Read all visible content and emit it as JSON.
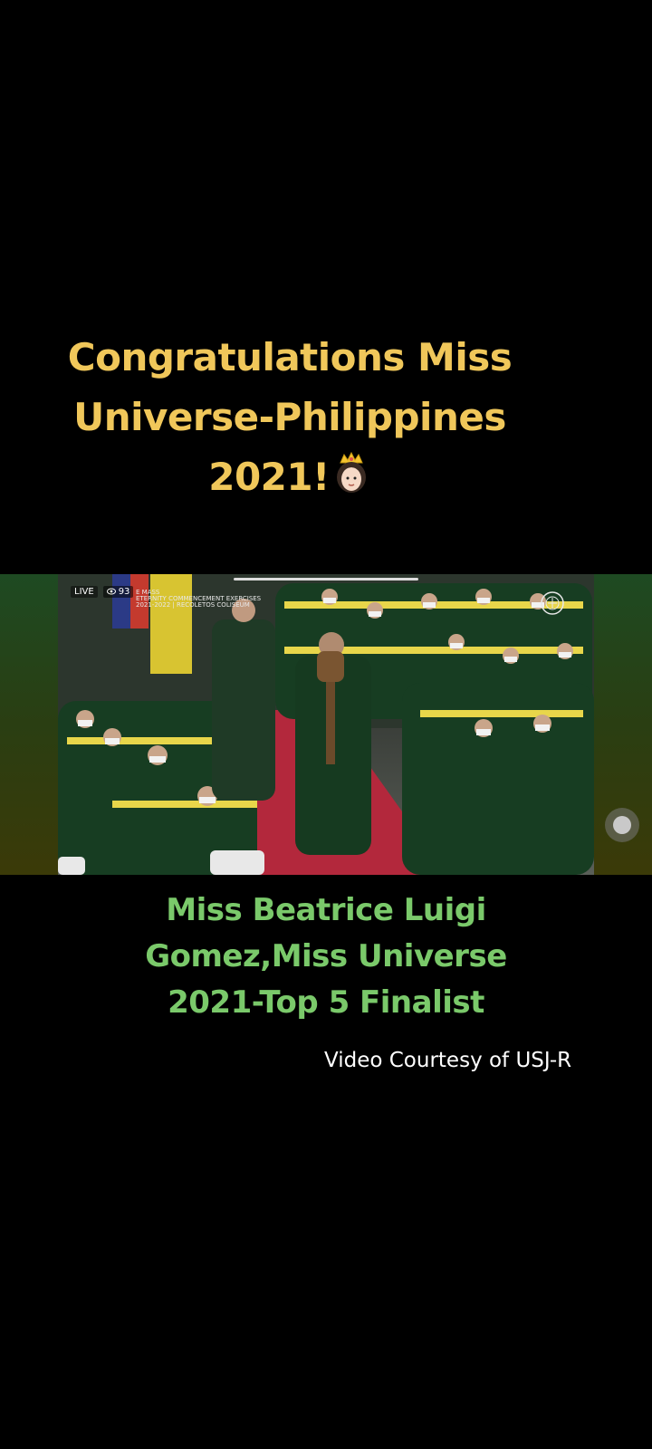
{
  "title": {
    "line1": "Congratulations Miss",
    "line2": "Universe-Philippines",
    "line3": "2021!",
    "emoji_icon": "princess-crown-emoji"
  },
  "video": {
    "live_label": "LIVE",
    "view_count": "93",
    "event_caption_line1": "E MASS",
    "event_caption_line2": "ETERNITY COMMENCEMENT EXERCISES",
    "event_caption_line3": "2021-2022 | RECOLETOS COLISEUM"
  },
  "subtitle": {
    "line1": "Miss Beatrice Luigi",
    "line2": "Gomez,Miss Universe",
    "line3": "2021-Top 5 Finalist"
  },
  "credit": "Video Courtesy of USJ-R",
  "colors": {
    "title": "#f0c75a",
    "subtitle": "#7ac96a",
    "credit": "#ffffff",
    "background": "#000000"
  }
}
